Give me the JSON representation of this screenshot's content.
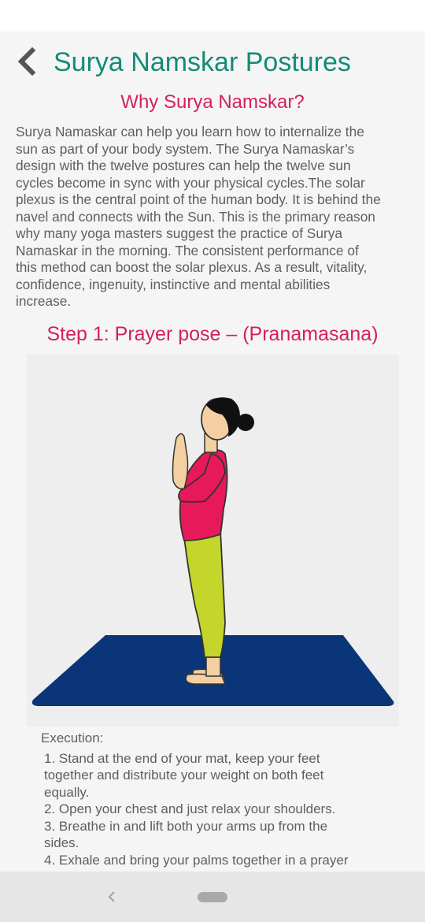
{
  "header": {
    "title": "Surya Namskar Postures",
    "back_icon": "chevron-left-icon"
  },
  "intro": {
    "heading": "Why Surya Namskar?",
    "lines": [
      "Surya Namaskar can help you learn how to internalize the",
      "sun as part of your body system. The Surya Namaskar’s",
      "design with the twelve postures can help the twelve sun",
      "cycles become in sync with your physical cycles.The solar",
      "plexus is the central point of the human body. It is behind the",
      "navel and connects with the Sun. This is the primary reason",
      "why many yoga masters suggest the practice of Surya",
      "Namaskar in the morning. The consistent performance of",
      "this method can boost the solar plexus. As a result, vitality,",
      "confidence, ingenuity, instinctive and mental abilities",
      "increase."
    ]
  },
  "step": {
    "title": "Step 1: Prayer pose – (Pranamasana)",
    "execution_label": "Execution:",
    "instructions": [
      "1. Stand at the end of your mat, keep your feet",
      "together and distribute your weight on both feet",
      "equally.",
      "2. Open your chest and just relax your shoulders.",
      "3. Breathe in and lift both your arms up from the",
      "sides.",
      "4. Exhale and bring your palms together in a prayer"
    ]
  },
  "colors": {
    "title": "#168a78",
    "accent": "#d3205f",
    "mat": "#0a3578",
    "shirt": "#e8195a",
    "pants": "#c4d62b",
    "skin": "#f4cfa1"
  },
  "nav": {
    "back_icon": "nav-back-icon",
    "home_icon": "home-pill-icon"
  }
}
